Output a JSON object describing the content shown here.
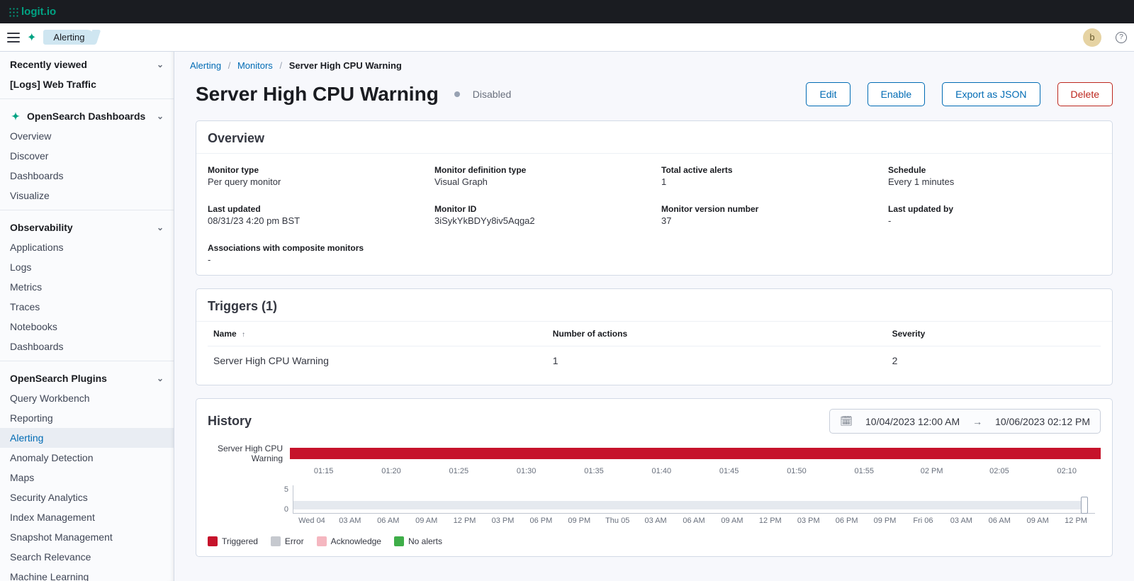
{
  "brand": "logit.io",
  "chip_label": "Alerting",
  "avatar_initial": "b",
  "sidebar": {
    "recently_viewed": {
      "title": "Recently viewed",
      "items": [
        "[Logs] Web Traffic"
      ]
    },
    "dashboards": {
      "title": "OpenSearch Dashboards",
      "items": [
        "Overview",
        "Discover",
        "Dashboards",
        "Visualize"
      ]
    },
    "observability": {
      "title": "Observability",
      "items": [
        "Applications",
        "Logs",
        "Metrics",
        "Traces",
        "Notebooks",
        "Dashboards"
      ]
    },
    "plugins": {
      "title": "OpenSearch Plugins",
      "items": [
        "Query Workbench",
        "Reporting",
        "Alerting",
        "Anomaly Detection",
        "Maps",
        "Security Analytics",
        "Index Management",
        "Snapshot Management",
        "Search Relevance",
        "Machine Learning"
      ]
    },
    "active_item": "Alerting"
  },
  "breadcrumbs": [
    "Alerting",
    "Monitors",
    "Server High CPU Warning"
  ],
  "page": {
    "title": "Server High CPU Warning",
    "status": "Disabled",
    "actions": {
      "edit": "Edit",
      "enable": "Enable",
      "export": "Export as JSON",
      "delete": "Delete"
    }
  },
  "overview": {
    "title": "Overview",
    "fields": {
      "monitor_type": {
        "label": "Monitor type",
        "value": "Per query monitor"
      },
      "definition_type": {
        "label": "Monitor definition type",
        "value": "Visual Graph"
      },
      "active_alerts": {
        "label": "Total active alerts",
        "value": "1"
      },
      "schedule": {
        "label": "Schedule",
        "value": "Every 1 minutes"
      },
      "last_updated": {
        "label": "Last updated",
        "value": "08/31/23 4:20 pm BST"
      },
      "monitor_id": {
        "label": "Monitor ID",
        "value": "3iSykYkBDYy8iv5Aqga2"
      },
      "version": {
        "label": "Monitor version number",
        "value": "37"
      },
      "updated_by": {
        "label": "Last updated by",
        "value": "-"
      },
      "associations": {
        "label": "Associations with composite monitors",
        "value": "-"
      }
    }
  },
  "triggers": {
    "title": "Triggers (1)",
    "columns": {
      "name": "Name",
      "actions": "Number of actions",
      "severity": "Severity"
    },
    "rows": [
      {
        "name": "Server High CPU Warning",
        "actions": "1",
        "severity": "2"
      }
    ]
  },
  "history": {
    "title": "History",
    "range_start": "10/04/2023 12:00 AM",
    "range_end": "10/06/2023 02:12 PM",
    "series_label": "Server High CPU Warning",
    "time_ticks": [
      "01:15",
      "01:20",
      "01:25",
      "01:30",
      "01:35",
      "01:40",
      "01:45",
      "01:50",
      "01:55",
      "02 PM",
      "02:05",
      "02:10"
    ],
    "brush_y": [
      "5",
      "0"
    ],
    "brush_ticks": [
      "Wed 04",
      "03 AM",
      "06 AM",
      "09 AM",
      "12 PM",
      "03 PM",
      "06 PM",
      "09 PM",
      "Thu 05",
      "03 AM",
      "06 AM",
      "09 AM",
      "12 PM",
      "03 PM",
      "06 PM",
      "09 PM",
      "Fri 06",
      "03 AM",
      "06 AM",
      "09 AM",
      "12 PM"
    ],
    "legend": [
      {
        "label": "Triggered",
        "color": "#c6132b"
      },
      {
        "label": "Error",
        "color": "#c6c9cf"
      },
      {
        "label": "Acknowledge",
        "color": "#f5b7c0"
      },
      {
        "label": "No alerts",
        "color": "#3fae49"
      }
    ]
  },
  "chart_data": {
    "type": "bar",
    "title": "History",
    "series_name": "Server High CPU Warning",
    "x_range": [
      "2023-10-04T00:00",
      "2023-10-06T14:12"
    ],
    "detail_window": [
      "2023-10-06T13:12",
      "2023-10-06T14:12"
    ],
    "detail_ticks": [
      "01:15",
      "01:20",
      "01:25",
      "01:30",
      "01:35",
      "01:40",
      "01:45",
      "01:50",
      "01:55",
      "02 PM",
      "02:05",
      "02:10"
    ],
    "detail_state": "Triggered",
    "legend_states": [
      "Triggered",
      "Error",
      "Acknowledge",
      "No alerts"
    ],
    "overview_ylim": [
      0,
      5
    ]
  }
}
